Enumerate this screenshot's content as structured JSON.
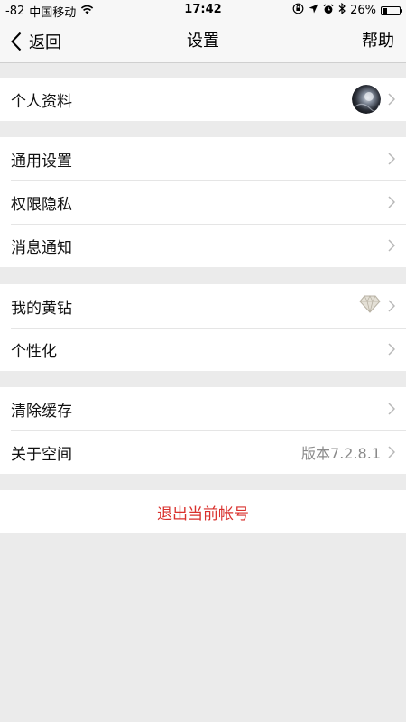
{
  "status_bar": {
    "signal": "-82",
    "carrier": "中国移动",
    "time": "17:42",
    "battery_percent": "26%",
    "battery_level": 0.26,
    "icons": [
      "wifi-icon",
      "orientation-lock-icon",
      "location-arrow-icon",
      "alarm-icon",
      "bluetooth-icon",
      "battery-icon"
    ]
  },
  "nav": {
    "back_label": "返回",
    "title": "设置",
    "help_label": "帮助"
  },
  "groups": {
    "profile": {
      "items": [
        {
          "label": "个人资料",
          "right": "avatar"
        }
      ]
    },
    "general": {
      "items": [
        {
          "label": "通用设置"
        },
        {
          "label": "权限隐私"
        },
        {
          "label": "消息通知"
        }
      ]
    },
    "vip": {
      "items": [
        {
          "label": "我的黄钻",
          "right": "diamond-icon"
        },
        {
          "label": "个性化"
        }
      ]
    },
    "misc": {
      "items": [
        {
          "label": "清除缓存"
        },
        {
          "label": "关于空间",
          "value": "版本7.2.8.1"
        }
      ]
    }
  },
  "logout": {
    "label": "退出当前帐号"
  },
  "colors": {
    "background": "#ebebeb",
    "bar": "#f7f7f7",
    "logout_text": "#d9302c",
    "value_text": "#8a8a8a",
    "chevron": "#b8b8b8",
    "separator": "#e5e5e5"
  }
}
